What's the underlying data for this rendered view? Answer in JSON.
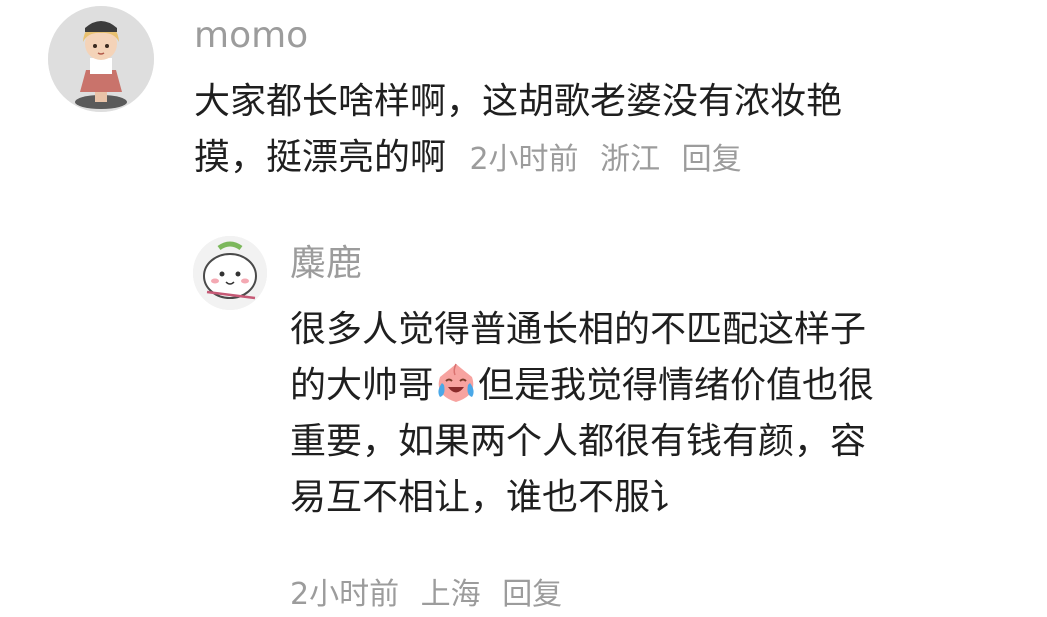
{
  "comments": [
    {
      "username": "momo",
      "text_line1": "大家都长啥样啊，这胡歌老婆没有浓妆艳",
      "text_line2": "摸，挺漂亮的啊",
      "time": "2小时前",
      "location": "浙江",
      "reply_label": "回复",
      "avatar_icon": "cartoon-girl-avatar-icon"
    }
  ],
  "replies": [
    {
      "username": "麋鹿",
      "line1": "很多人觉得普通长相的不匹配这样子",
      "line2_before": "的大帅哥",
      "emoji": "crying-laughing-peach-emoji-icon",
      "line2_after": "但是我觉得情绪价值也很",
      "line3": "重要，如果两个人都很有钱有颜，容",
      "line4": "易互不相让，谁也不服讠",
      "time": "2小时前",
      "location": "上海",
      "reply_label": "回复",
      "avatar_icon": "white-bunny-avatar-icon"
    }
  ],
  "colors": {
    "text": "#1f1f1f",
    "meta": "#9c9c9c",
    "background": "#ffffff"
  }
}
